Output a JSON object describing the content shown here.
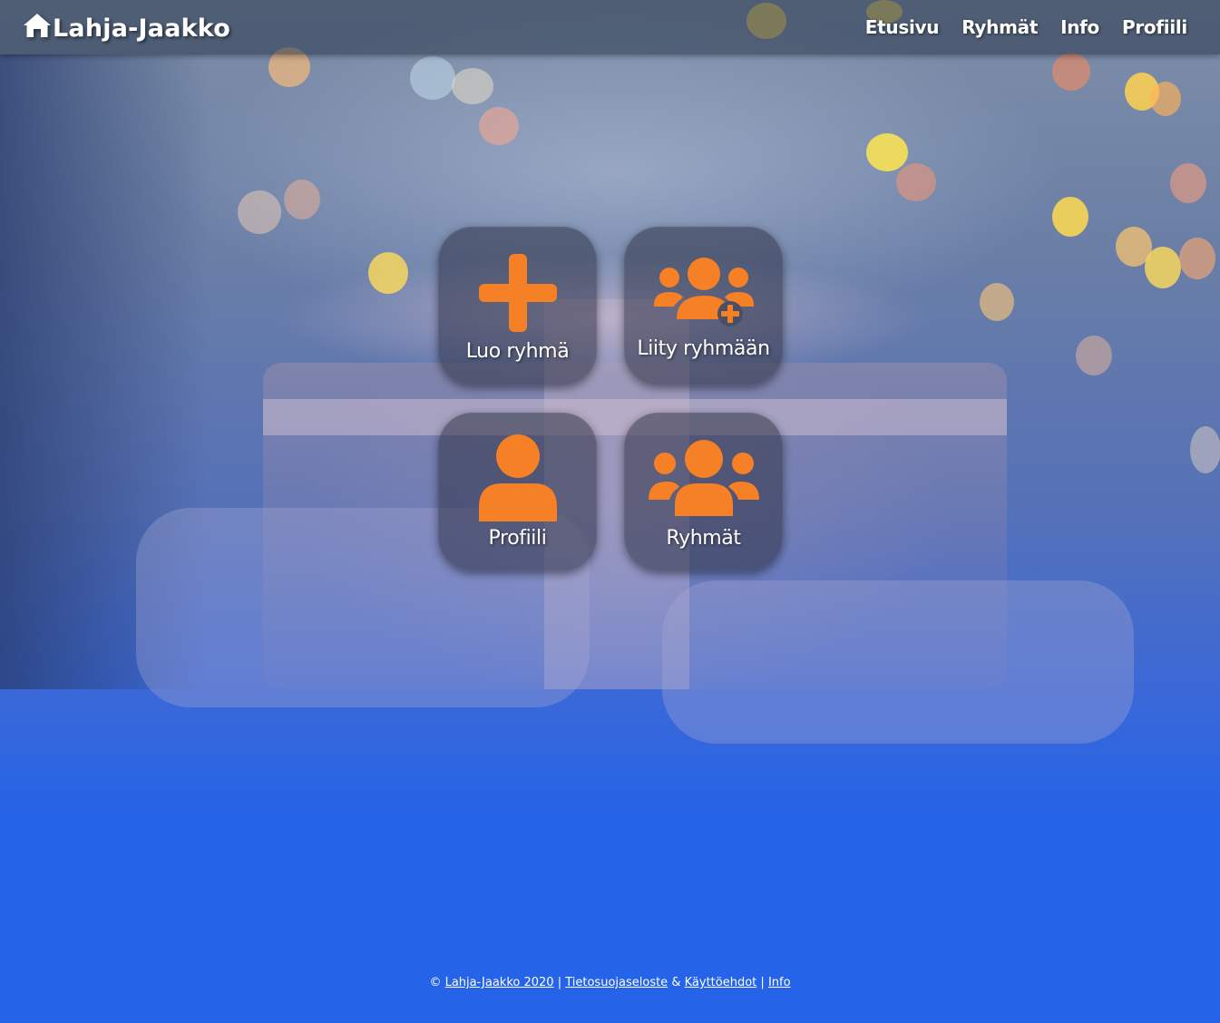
{
  "navbar": {
    "brand": "Lahja-Jaakko",
    "links": [
      "Etusivu",
      "Ryhmät",
      "Info",
      "Profiili"
    ]
  },
  "tiles": [
    {
      "label": "Luo ryhmä",
      "icon": "plus-icon"
    },
    {
      "label": "Liity ryhmään",
      "icon": "users-plus-icon"
    },
    {
      "label": "Profiili",
      "icon": "user-icon"
    },
    {
      "label": "Ryhmät",
      "icon": "users-icon"
    }
  ],
  "footer": {
    "copyright": "©",
    "brand_link": "Lahja-Jaakko 2020",
    "sep1": "|",
    "privacy_link": "Tietosuojaseloste",
    "amp": "&",
    "terms_link": "Käyttöehdot",
    "sep2": "|",
    "info_link": "Info"
  },
  "colors": {
    "accent": "#f58025",
    "page_blue": "#2563e8",
    "navbar": "#28374b",
    "tile": "#2d3246"
  }
}
